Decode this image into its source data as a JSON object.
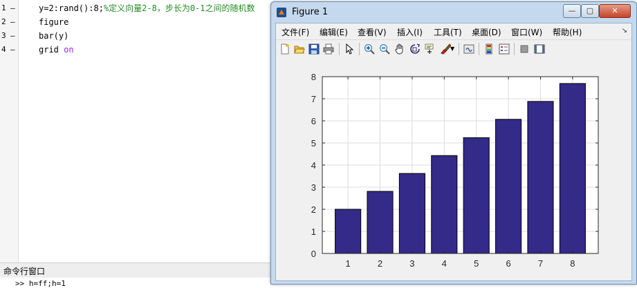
{
  "editor": {
    "lines": [
      {
        "num": "1",
        "dash": "–",
        "code_a": "y=2:rand():8;",
        "comment": "%定义向量2-8，步长为0-1之间的随机数"
      },
      {
        "num": "2",
        "dash": "–",
        "code": "figure"
      },
      {
        "num": "3",
        "dash": "–",
        "code": "bar(y)"
      },
      {
        "num": "4",
        "dash": "–",
        "code_a": "grid ",
        "keyword": "on"
      }
    ]
  },
  "command_window": {
    "title": "命令行窗口",
    "prompt": ">> h=ff;h=1"
  },
  "figure": {
    "title": "Figure 1",
    "window_buttons": {
      "minimize": "—",
      "maximize": "▢",
      "close": "✕"
    },
    "menus": [
      "文件(F)",
      "编辑(E)",
      "查看(V)",
      "插入(I)",
      "工具(T)",
      "桌面(D)",
      "窗口(W)",
      "帮助(H)"
    ],
    "menu_overflow": "↘",
    "toolbar_icons": [
      "new-figure-icon",
      "open-file-icon",
      "save-icon",
      "print-icon",
      "edit-plot-icon",
      "zoom-in-icon",
      "zoom-out-icon",
      "pan-icon",
      "rotate-3d-icon",
      "data-cursor-icon",
      "brush-icon",
      "brush-dropdown-icon",
      "link-plot-icon",
      "colorbar-icon",
      "legend-icon",
      "hide-plot-tools-icon",
      "show-plot-tools-icon"
    ]
  },
  "chart_data": {
    "type": "bar",
    "categories": [
      "1",
      "2",
      "3",
      "4",
      "5",
      "6",
      "7",
      "8"
    ],
    "values": [
      2.0,
      2.81,
      3.62,
      4.43,
      5.24,
      6.07,
      6.88,
      7.69
    ],
    "yticks": [
      "0",
      "1",
      "2",
      "3",
      "4",
      "5",
      "6",
      "7",
      "8"
    ],
    "ylim": [
      0,
      8
    ],
    "xlim": [
      0.2,
      8.8
    ],
    "grid": true,
    "bar_color": "#332b87",
    "bar_edge": "#000000"
  }
}
